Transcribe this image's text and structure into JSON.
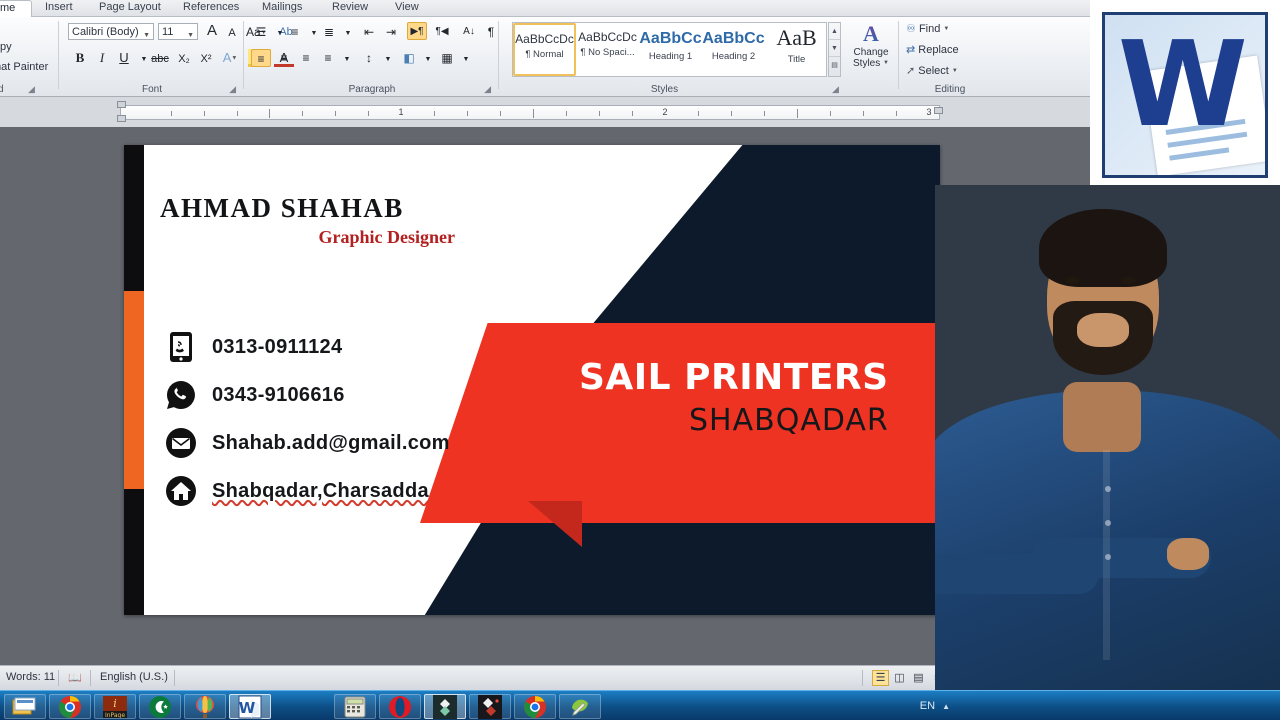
{
  "app": {
    "name": "Microsoft Word 2010",
    "logo_letter": "W"
  },
  "ribbon": {
    "tabs": [
      {
        "label": "me",
        "active": true
      },
      {
        "label": "Insert",
        "active": false
      },
      {
        "label": "Page Layout",
        "active": false
      },
      {
        "label": "References",
        "active": false
      },
      {
        "label": "Mailings",
        "active": false
      },
      {
        "label": "Review",
        "active": false
      },
      {
        "label": "View",
        "active": false
      }
    ],
    "clipboard": {
      "group_label": "d",
      "copy_label": "py",
      "format_painter_label": "mat Painter"
    },
    "font": {
      "group_label": "Font",
      "font_name": "Calibri (Body)",
      "font_size": "11",
      "grow_font": "A",
      "shrink_font": "A",
      "change_case": "Aa",
      "clear_formatting": "Ab",
      "bold": "B",
      "italic": "I",
      "underline": "U",
      "strikethrough": "abc",
      "subscript": "X₂",
      "superscript": "X²",
      "text_effects": "A",
      "highlight": "ab",
      "font_color": "A"
    },
    "paragraph": {
      "group_label": "Paragraph",
      "bullets": "☰",
      "numbering": "≡",
      "multilevel": "≣",
      "decrease_indent": "⇤",
      "increase_indent": "⇥",
      "ltr": "▶¶",
      "rtl": "¶◀",
      "sort": "A↓",
      "show_marks": "¶",
      "align_left": "≡",
      "align_center": "≡",
      "align_right": "≡",
      "justify": "≡",
      "line_spacing": "↕",
      "shading": "◧",
      "borders": "▦"
    },
    "styles": {
      "group_label": "Styles",
      "gallery": [
        {
          "preview": "AaBbCcDc",
          "name": "¶ Normal",
          "selected": true
        },
        {
          "preview": "AaBbCcDc",
          "name": "¶ No Spaci...",
          "selected": false
        },
        {
          "preview": "AaBbCс",
          "name": "Heading 1",
          "selected": false
        },
        {
          "preview": "AaBbCc",
          "name": "Heading 2",
          "selected": false
        },
        {
          "preview": "AaB",
          "name": "Title",
          "selected": false
        }
      ],
      "change_styles_line1": "Change",
      "change_styles_line2": "Styles",
      "scroll_up": "▲",
      "scroll_down": "▼",
      "scroll_more": "▤"
    },
    "editing": {
      "group_label": "Editing",
      "find_label": "Find",
      "replace_label": "Replace",
      "select_label": "Select"
    }
  },
  "ruler": {
    "numbers": [
      "1",
      "2",
      "3"
    ]
  },
  "card": {
    "name": "AHMAD SHAHAB",
    "role": "Graphic Designer",
    "contacts": [
      {
        "icon": "mobile-phone-icon",
        "text": "0313-0911124",
        "misspelled": false
      },
      {
        "icon": "whatsapp-icon",
        "text": "0343-9106616",
        "misspelled": false
      },
      {
        "icon": "envelope-icon",
        "text": "Shahab.add@gmail.com",
        "misspelled": false
      },
      {
        "icon": "home-icon",
        "text": "Shabqadar,Charsadda",
        "misspelled": true
      }
    ],
    "brand_main": "SAIL PRINTERS",
    "brand_sub": "SHABQADAR",
    "colors": {
      "orange": "#ee6622",
      "red": "#ee3322",
      "red_fold": "#c4281c",
      "navy": "#0d1a2b",
      "black": "#0d0d10",
      "role_red": "#b2201f"
    }
  },
  "statusbar": {
    "word_count": "Words: 11",
    "proofing_icon": "spellcheck-icon",
    "language": "English (U.S.)",
    "view_buttons": [
      {
        "icon": "print-layout-view-icon",
        "glyph": "☰",
        "selected": true
      },
      {
        "icon": "full-screen-reading-view-icon",
        "glyph": "◫",
        "selected": false
      },
      {
        "icon": "web-layout-view-icon",
        "glyph": "▤",
        "selected": false
      },
      {
        "icon": "outline-view-icon",
        "glyph": "≡",
        "selected": false
      }
    ]
  },
  "taskbar": {
    "items": [
      {
        "name": "windows-explorer",
        "glyph": "🗂",
        "active": false
      },
      {
        "name": "google-chrome",
        "glyph": "",
        "active": false
      },
      {
        "name": "inpage",
        "glyph": "i⃩",
        "active": false
      },
      {
        "name": "pakistan-flag-app",
        "glyph": "☪",
        "active": false
      },
      {
        "name": "hot-air-balloon-app",
        "glyph": "",
        "active": false
      },
      {
        "name": "microsoft-word",
        "glyph": "W",
        "active": true
      },
      {
        "name": "calculator",
        "glyph": "⌨",
        "active": false
      },
      {
        "name": "opera-browser",
        "glyph": "O",
        "active": false
      },
      {
        "name": "diamond-app-one",
        "glyph": "◆",
        "active": true
      },
      {
        "name": "diamond-app-two",
        "glyph": "◆",
        "active": false
      },
      {
        "name": "google-chrome-second",
        "glyph": "",
        "active": false
      },
      {
        "name": "green-pencil-app",
        "glyph": "✎",
        "active": false
      }
    ],
    "tray": {
      "language": "EN",
      "show_hidden": "▲"
    }
  }
}
